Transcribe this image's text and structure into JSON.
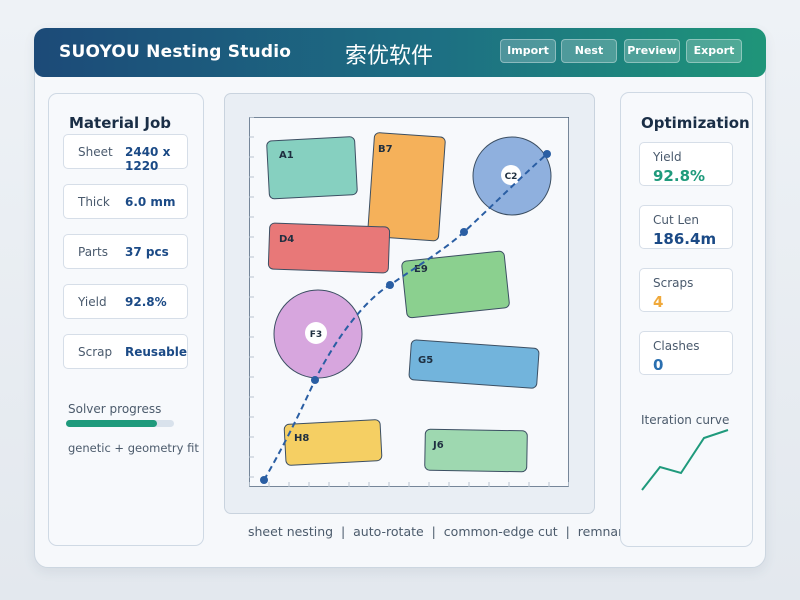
{
  "header": {
    "app_title": "SUOYOU Nesting Studio",
    "app_title_cn": "索优软件",
    "buttons": [
      {
        "label": "Import"
      },
      {
        "label": "Nest"
      },
      {
        "label": "Preview"
      },
      {
        "label": "Export"
      }
    ]
  },
  "material_job": {
    "title": "Material Job",
    "fields": [
      {
        "key": "Sheet",
        "value": "2440 x 1220"
      },
      {
        "key": "Thick",
        "value": "6.0 mm"
      },
      {
        "key": "Parts",
        "value": "37 pcs"
      },
      {
        "key": "Yield",
        "value": "92.8%"
      },
      {
        "key": "Scrap",
        "value": "Reusable"
      }
    ],
    "progress_label": "Solver progress",
    "progress_fraction": 0.84,
    "progress_color": "#1f9a7c",
    "method_text": "genetic + geometry fit"
  },
  "optimization": {
    "title": "Optimization",
    "metrics": [
      {
        "key": "Yield",
        "value": "92.8%",
        "color": "#1f9a7c"
      },
      {
        "key": "Cut Len",
        "value": "186.4m",
        "color": "#1b4a86"
      },
      {
        "key": "Scraps",
        "value": "4",
        "color": "#f0a93b"
      },
      {
        "key": "Clashes",
        "value": "0",
        "color": "#2a6fb0"
      }
    ],
    "curve_label": "Iteration curve",
    "curve_color": "#1f9a7c"
  },
  "footer": {
    "text": "sheet nesting  |  auto-rotate  |  common-edge cut  |  remnant stock"
  },
  "parts": [
    {
      "id": "A1",
      "color": "#86d0c0"
    },
    {
      "id": "B7",
      "color": "#f5b15a"
    },
    {
      "id": "C2",
      "color": "#8fb0de"
    },
    {
      "id": "D4",
      "color": "#e87878"
    },
    {
      "id": "E9",
      "color": "#8bd08f"
    },
    {
      "id": "F3",
      "color": "#d7a6de"
    },
    {
      "id": "G5",
      "color": "#72b4dc"
    },
    {
      "id": "H8",
      "color": "#f5cf63"
    },
    {
      "id": "J6",
      "color": "#9ed8b0"
    }
  ]
}
